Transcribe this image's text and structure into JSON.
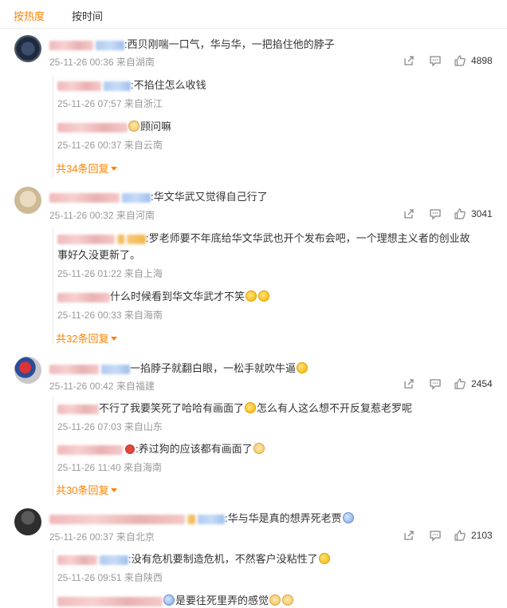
{
  "tabs": [
    "按热度",
    "按时间"
  ],
  "comments": [
    {
      "text": ":西贝刚喘一口气，华与华，一把掐住他的脖子",
      "meta": "25-11-26 00:36 来自湖南",
      "likes": "4898",
      "replies": [
        {
          "text": ":不掐住怎么收钱",
          "meta": "25-11-26 07:57 来自浙江"
        },
        {
          "text": "顾问嘛",
          "meta": "25-11-26 00:37 来自云南"
        }
      ],
      "more": "共34条回复"
    },
    {
      "text": ":华文华武又觉得自己行了",
      "meta": "25-11-26 00:32 来自河南",
      "likes": "3041",
      "replies": [
        {
          "text": ":罗老师要不年底给华文华武也开个发布会吧，一个理想主义者的创业故",
          "text2": "事好久没更新了。",
          "meta": "25-11-26 01:22 来自上海"
        },
        {
          "text": "什么时候看到华文华武才不笑",
          "meta": "25-11-26 00:33 来自海南"
        }
      ],
      "more": "共32条回复"
    },
    {
      "text": "一掐脖子就翻白眼，一松手就吹牛逼",
      "meta": "25-11-26 00:42 来自福建",
      "likes": "2454",
      "replies": [
        {
          "text": "不行了我要笑死了哈哈有画面了",
          "text_b": "怎么有人这么想不开反复惹老罗呢",
          "meta": "25-11-26 07:03 来自山东"
        },
        {
          "text": ":养过狗的应该都有画面了",
          "meta": "25-11-26 11:40 来自海南"
        }
      ],
      "more": "共30条回复"
    },
    {
      "text": ":华与华是真的想弄死老贾",
      "meta": "25-11-26 00:37 来自北京",
      "likes": "2103",
      "replies": [
        {
          "text": ":没有危机要制造危机，不然客户没粘性了",
          "meta": "25-11-26 09:51 来自陕西"
        },
        {
          "text": "是要往死里弄的感觉",
          "meta": ""
        }
      ]
    }
  ],
  "colors": {
    "accent": "#ff8200",
    "meta": "#999999",
    "text": "#333333"
  },
  "icons": [
    "share-icon",
    "comment-icon",
    "like-icon",
    "caret-down-icon"
  ]
}
